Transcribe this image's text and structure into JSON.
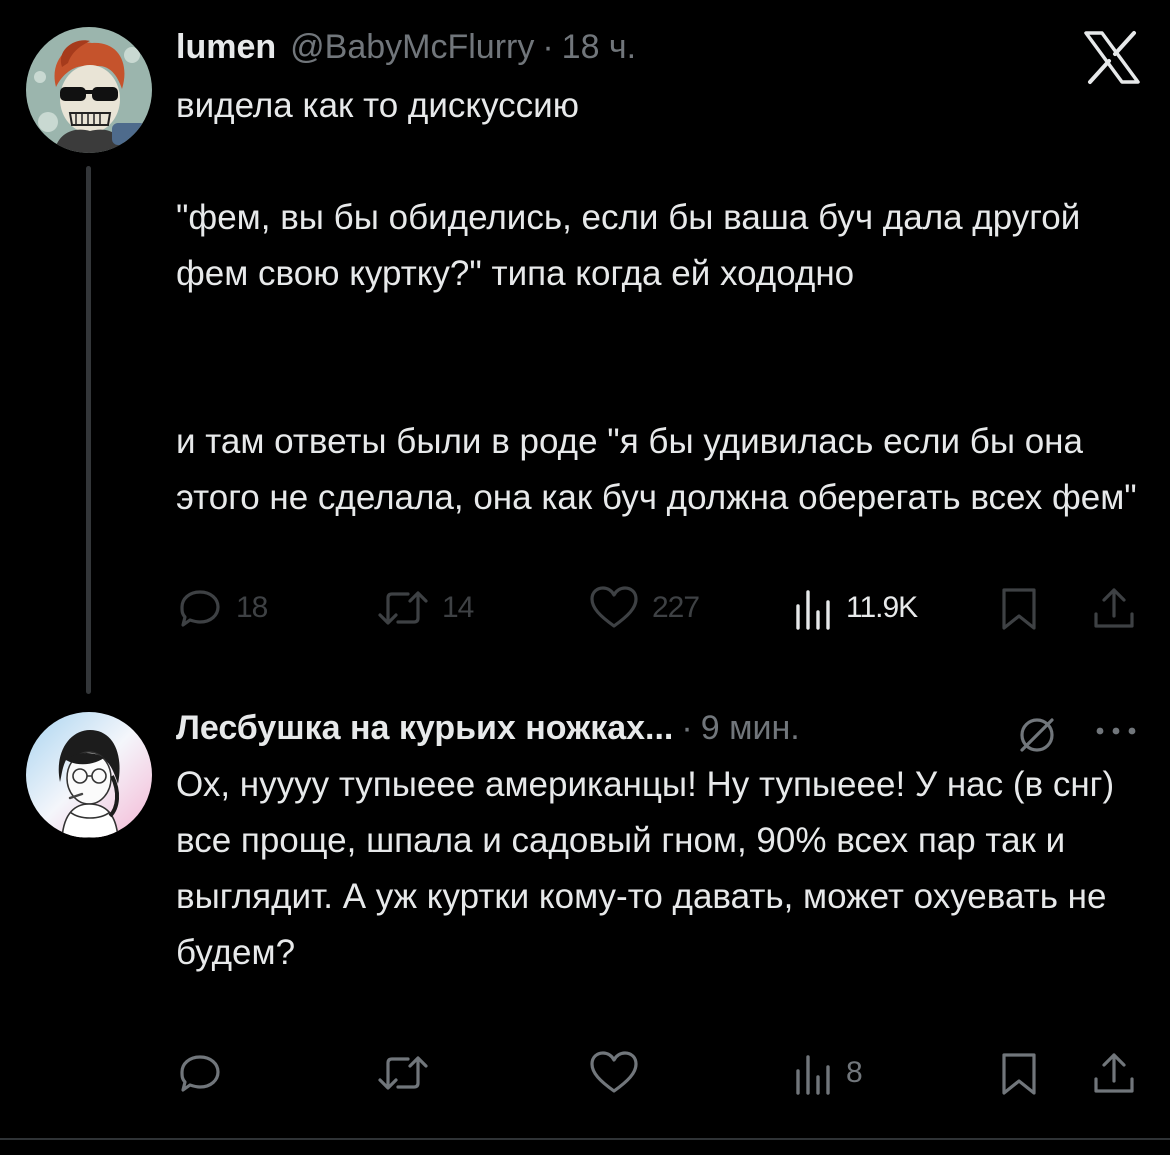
{
  "colors": {
    "background": "#000000",
    "text_primary": "#e7e9ea",
    "text_secondary": "#71767b",
    "icon_dimmed": "#3e4144",
    "thread_line": "#333639"
  },
  "tweet1": {
    "display_name": "lumen",
    "handle": "@BabyMcFlurry",
    "separator": "·",
    "time": "18 ч.",
    "text": "видела как то дискуссию\n\n\"фем, вы бы обиделись, если бы ваша буч дала другой фем свою куртку?\" типа когда ей хододно\n\n\nи там ответы были в роде \"я бы удивилась если бы она этого не сделала, она как буч должна оберегать всех фем\"",
    "actions": {
      "replies": "18",
      "reposts": "14",
      "likes": "227",
      "views": "11.9K"
    },
    "icons": [
      "x-logo-icon",
      "reply-icon",
      "repost-icon",
      "like-icon",
      "views-icon",
      "bookmark-icon",
      "share-icon"
    ]
  },
  "tweet2": {
    "display_name": "Лесбушка на курьих ножках...",
    "separator": "·",
    "time": "9 мин.",
    "text": "Ох, нуууу тупыеее американцы! Ну тупыеее! У нас (в снг) все проще, шпала и садовый гном, 90% всех пар так и выглядит. А уж куртки кому-то давать, может охуевать не будем?",
    "actions": {
      "views": "8"
    },
    "icons": [
      "globe-slash-icon",
      "more-icon",
      "reply-icon",
      "repost-icon",
      "like-icon",
      "views-icon",
      "bookmark-icon",
      "share-icon"
    ]
  }
}
